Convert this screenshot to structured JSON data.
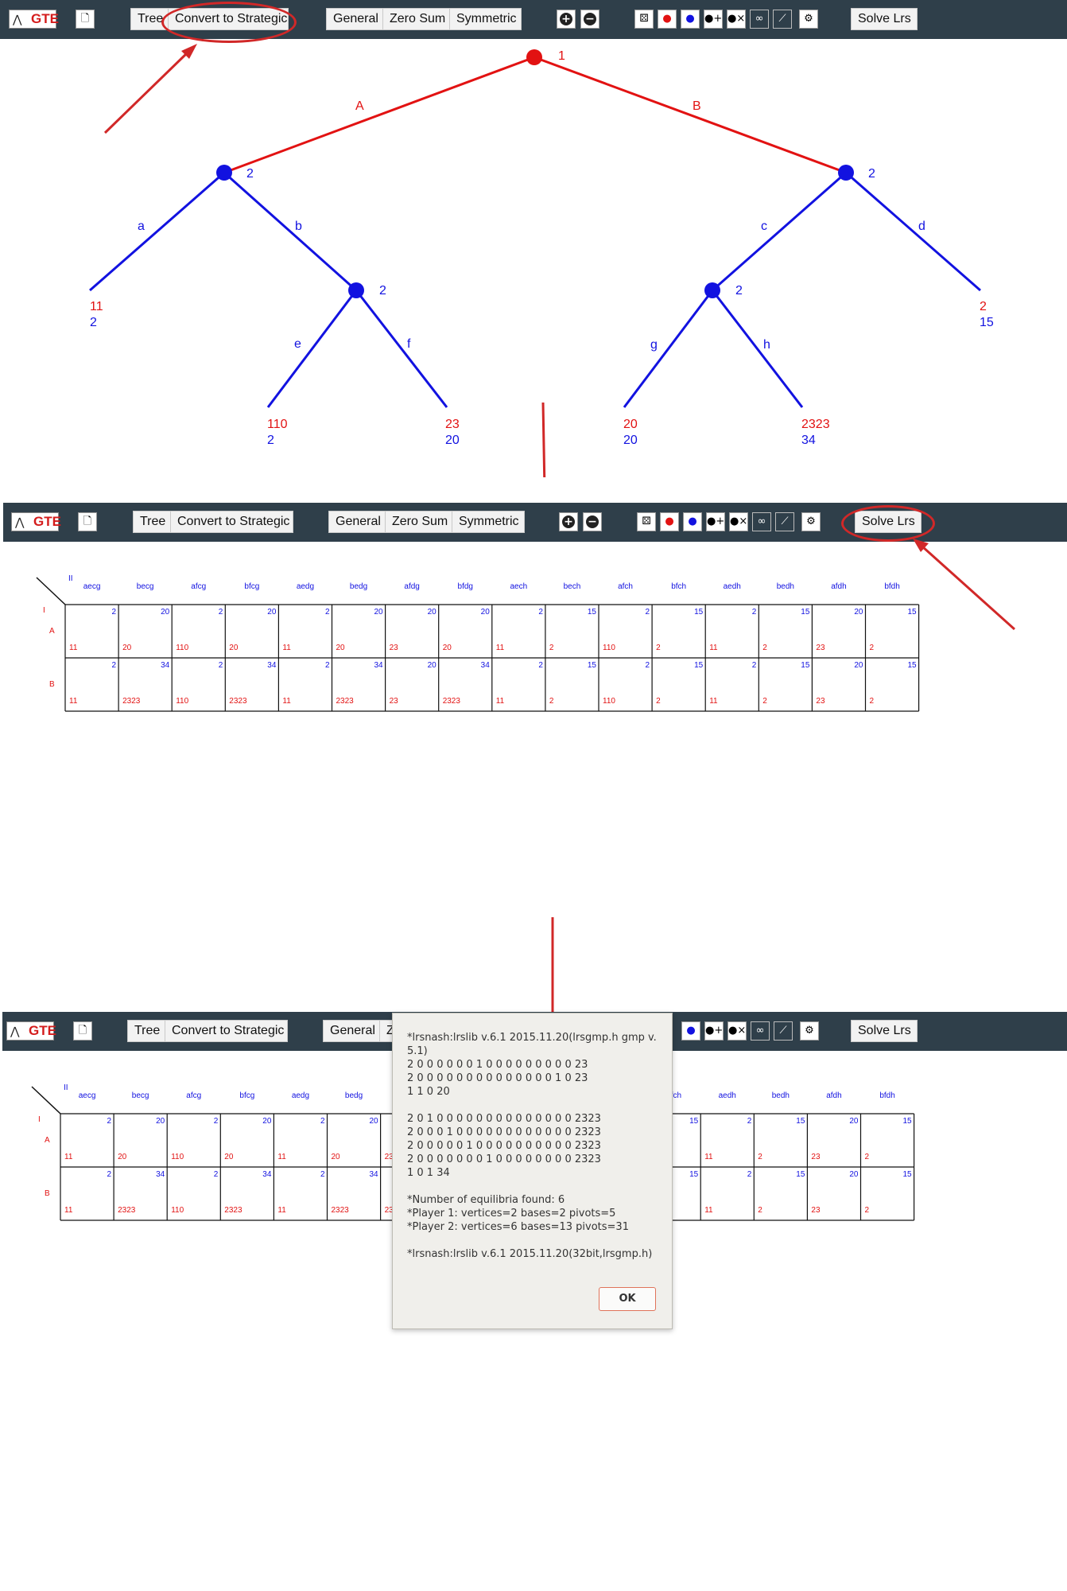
{
  "app": {
    "logo_text": "GTE",
    "logo_mark": "⋀"
  },
  "toolbar": {
    "tree_label": "Tree",
    "convert_label": "Convert to Strategic",
    "general_label": "General",
    "zero_sum_label": "Zero Sum",
    "symmetric_label": "Symmetric",
    "solve_label": "Solve Lrs",
    "zero_sum_truncated": "Z"
  },
  "tree": {
    "root_player": "1",
    "move_A": "A",
    "move_B": "B",
    "player2": "2",
    "move_a": "a",
    "move_b": "b",
    "move_c": "c",
    "move_d": "d",
    "move_e": "e",
    "move_f": "f",
    "move_g": "g",
    "move_h": "h",
    "payoffs": [
      {
        "p1": "11",
        "p2": "2"
      },
      {
        "p1": "110",
        "p2": "2"
      },
      {
        "p1": "23",
        "p2": "20"
      },
      {
        "p1": "20",
        "p2": "20"
      },
      {
        "p1": "2323",
        "p2": "34"
      },
      {
        "p1": "2",
        "p2": "15"
      }
    ]
  },
  "matrix": {
    "player1_label": "I",
    "player2_label": "II",
    "rows": [
      "A",
      "B"
    ],
    "columns": [
      "aecg",
      "becg",
      "afcg",
      "bfcg",
      "aedg",
      "bedg",
      "afdg",
      "bfdg",
      "aech",
      "bech",
      "afch",
      "bfch",
      "aedh",
      "bedh",
      "afdh",
      "bfdh"
    ],
    "cells": {
      "A": {
        "p2": [
          "2",
          "20",
          "2",
          "20",
          "2",
          "20",
          "20",
          "20",
          "2",
          "15",
          "2",
          "15",
          "2",
          "15",
          "20",
          "15"
        ],
        "p1": [
          "11",
          "20",
          "110",
          "20",
          "11",
          "20",
          "23",
          "20",
          "11",
          "2",
          "110",
          "2",
          "11",
          "2",
          "23",
          "2"
        ]
      },
      "B": {
        "p2": [
          "2",
          "34",
          "2",
          "34",
          "2",
          "34",
          "20",
          "34",
          "2",
          "15",
          "2",
          "15",
          "2",
          "15",
          "20",
          "15"
        ],
        "p1": [
          "11",
          "2323",
          "110",
          "2323",
          "11",
          "2323",
          "23",
          "2323",
          "11",
          "2",
          "110",
          "2",
          "11",
          "2",
          "23",
          "2"
        ]
      }
    }
  },
  "dialog": {
    "lines": [
      "*lrsnash:lrslib v.6.1 2015.11.20(lrsgmp.h gmp v.",
      "5.1)",
      "2 0 0 0 0 0 0 1 0 0 0 0 0 0 0 0 0 23",
      "2 0 0 0 0 0 0 0 0 0 0 0 0 0 0 1 0 23",
      "1 1 0 20",
      "",
      "2 0 1 0 0 0 0 0 0 0 0 0 0 0 0 0 0 2323",
      "2 0 0 0 1 0 0 0 0 0 0 0 0 0 0 0 0 2323",
      "2 0 0 0 0 0 1 0 0 0 0 0 0 0 0 0 0 2323",
      "2 0 0 0 0 0 0 0 1 0 0 0 0 0 0 0 0 2323",
      "1 0 1 34",
      "",
      "*Number of equilibria found: 6",
      "*Player 1: vertices=2 bases=2 pivots=5",
      "*Player 2: vertices=6 bases=13 pivots=31",
      "",
      "*lrsnash:lrslib v.6.1 2015.11.20(32bit,lrsgmp.h)"
    ],
    "ok_label": "OK"
  },
  "colors": {
    "player1": "#e21212",
    "player2": "#1212e0",
    "toolbar": "#2f3f4a",
    "annotation": "#d12828"
  },
  "icons": [
    "new-file-icon",
    "zoom-in-icon",
    "zoom-out-icon",
    "random-payoff-icon",
    "player1-icon",
    "player2-icon",
    "add-player-icon",
    "delete-player-icon",
    "link-icon",
    "unlink-icon",
    "settings-icon"
  ]
}
